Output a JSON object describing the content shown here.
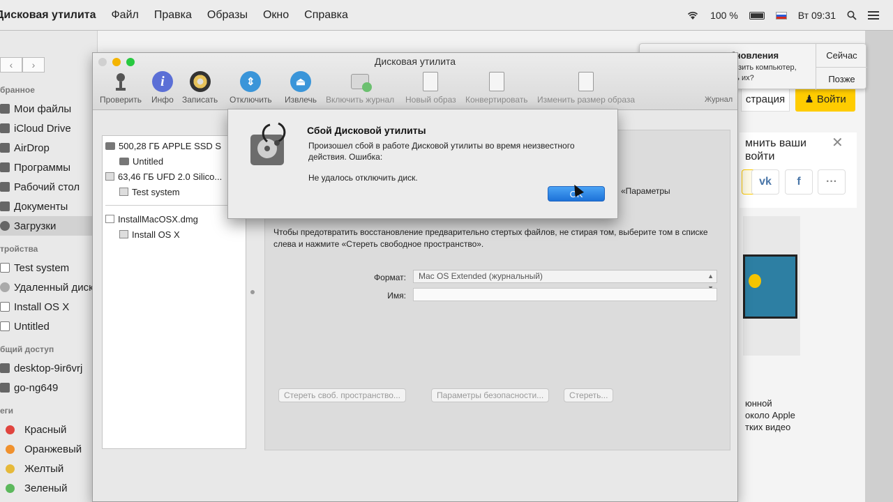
{
  "menubar": {
    "app": "Дисковая утилита",
    "items": [
      "Файл",
      "Правка",
      "Образы",
      "Окно",
      "Справка"
    ],
    "battery": "100 %",
    "clock": "Вт 09:31"
  },
  "finder": {
    "favorites_header": "бранное",
    "favorites": [
      "Мои файлы",
      "iCloud Drive",
      "AirDrop",
      "Программы",
      "Рабочий стол",
      "Документы",
      "Загрузки"
    ],
    "devices_header": "тройства",
    "devices": [
      "Test system",
      "Удаленный диск",
      "Install OS X",
      "Untitled"
    ],
    "shared_header": "бщий доступ",
    "shared": [
      "desktop-9ir6vrj",
      "go-ng649"
    ],
    "tags_header": "еги",
    "tags": [
      {
        "label": "Красный",
        "color": "#e0443e"
      },
      {
        "label": "Оранжевый",
        "color": "#f0912d"
      },
      {
        "label": "Желтый",
        "color": "#e6b93a"
      },
      {
        "label": "Зеленый",
        "color": "#5cb85c"
      }
    ]
  },
  "notification": {
    "title": "Доступны обновления",
    "body": "Хотите перезагрузить компьютер, чтобы установить их?",
    "now": "Сейчас",
    "later": "Позже"
  },
  "web": {
    "register": "страция",
    "login": "Войти",
    "promo": "мнить ваши войти",
    "side_text": [
      "юнной",
      "около Apple",
      "тких видео"
    ]
  },
  "du": {
    "title": "Дисковая утилита",
    "toolbar": [
      "Проверить",
      "Инфо",
      "Записать",
      "Отключить",
      "Извлечь",
      "Включить журнал",
      "Новый образ",
      "Конвертировать",
      "Изменить размер образа"
    ],
    "journal": "Журнал",
    "disks": [
      {
        "label": "500,28 ГБ APPLE SSD S",
        "level": 0
      },
      {
        "label": "Untitled",
        "level": 1
      },
      {
        "label": "63,46 ГБ UFD 2.0 Silico...",
        "level": 0
      },
      {
        "label": "Test system",
        "level": 1
      }
    ],
    "images": [
      {
        "label": "InstallMacOSX.dmg",
        "level": 0
      },
      {
        "label": "Install OS X",
        "level": 1
      }
    ],
    "partial_text": "«Параметры",
    "info": "Чтобы предотвратить восстановление предварительно стертых файлов, не стирая том, выберите том в списке слева и нажмите «Стереть свободное пространство».",
    "format_label": "Формат:",
    "format_value": "Mac OS Extended (журнальный)",
    "name_label": "Имя:",
    "btn_free": "Стереть своб. пространство...",
    "btn_security": "Параметры безопасности...",
    "btn_erase": "Стереть..."
  },
  "alert": {
    "title": "Сбой Дисковой утилиты",
    "message": "Произошел сбой в работе Дисковой утилиты во время неизвестного действия. Ошибка:",
    "detail": "Не удалось отключить диск.",
    "ok": "OK"
  }
}
